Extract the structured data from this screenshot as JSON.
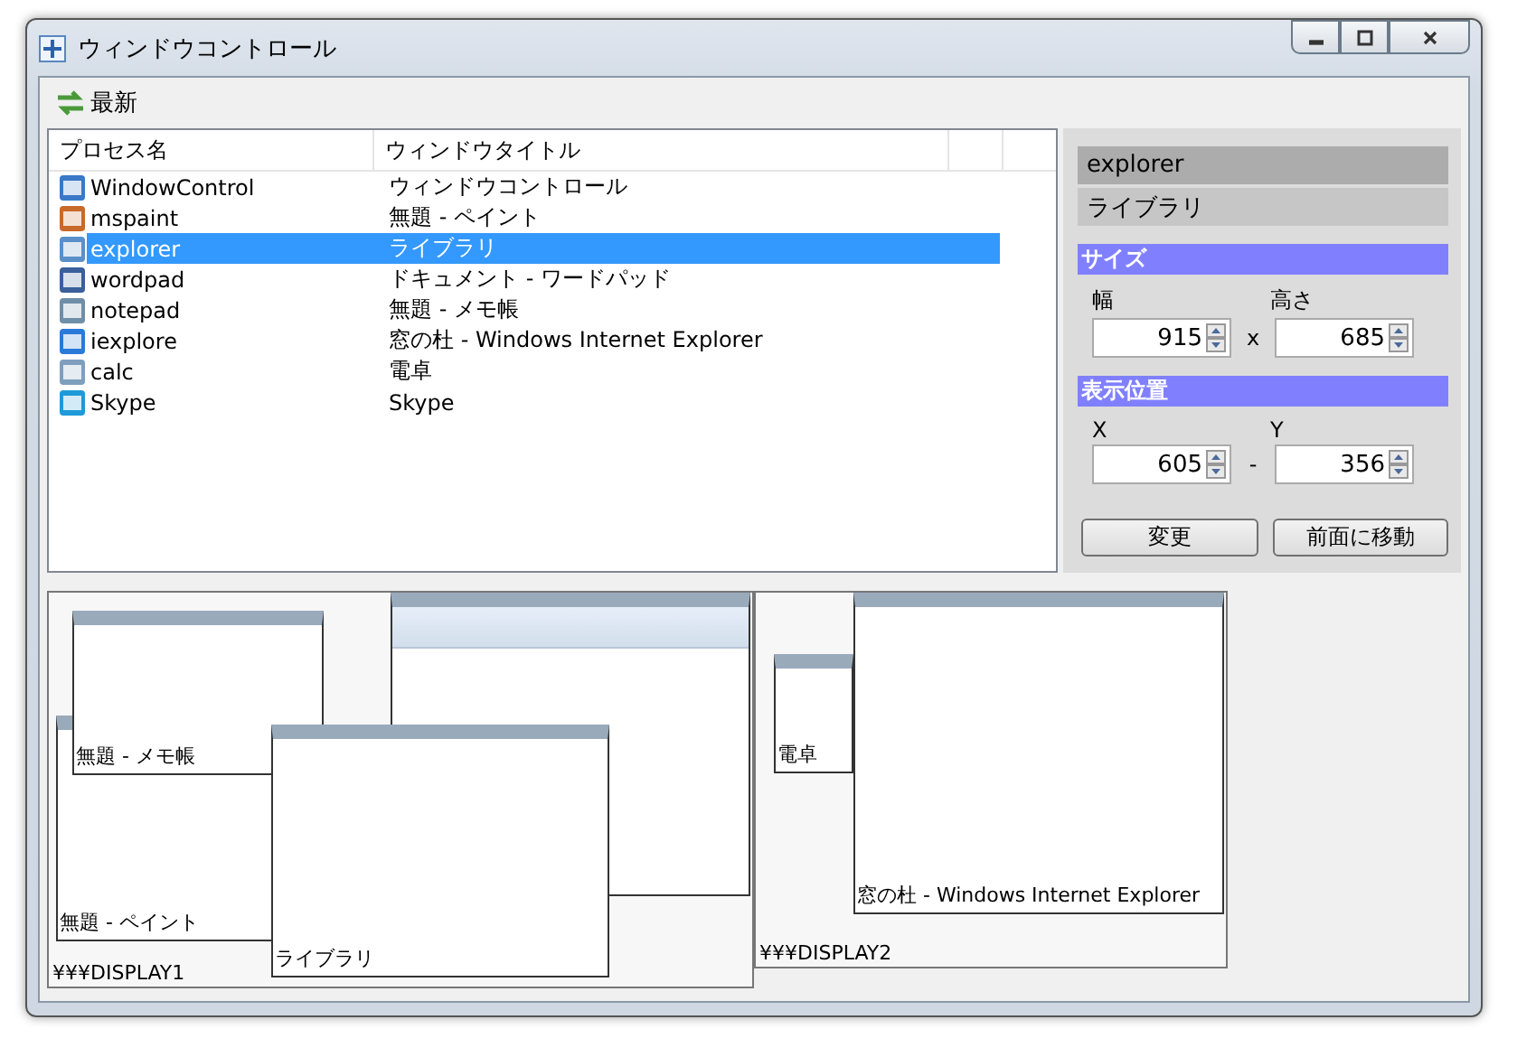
{
  "window": {
    "title": "ウィンドウコントロール"
  },
  "toolbar": {
    "refresh_button": "最新"
  },
  "process_list": {
    "columns": [
      "プロセス名",
      "ウィンドウタイトル"
    ],
    "rows": [
      {
        "process": "WindowControl",
        "title": "ウィンドウコントロール",
        "selected": false
      },
      {
        "process": "mspaint",
        "title": "無題 - ペイント",
        "selected": false
      },
      {
        "process": "explorer",
        "title": "ライブラリ",
        "selected": true
      },
      {
        "process": "wordpad",
        "title": "ドキュメント - ワードパッド",
        "selected": false
      },
      {
        "process": "notepad",
        "title": "無題 - メモ帳",
        "selected": false
      },
      {
        "process": "iexplore",
        "title": "窓の杜 - Windows Internet Explorer",
        "selected": false
      },
      {
        "process": "calc",
        "title": "電卓",
        "selected": false
      },
      {
        "process": "Skype",
        "title": "Skype",
        "selected": false
      }
    ]
  },
  "details": {
    "process": "explorer",
    "title": "ライブラリ",
    "size": {
      "heading": "サイズ",
      "first_label": "幅",
      "first_value": "915",
      "separator": "x",
      "second_label": "高さ",
      "second_value": "685"
    },
    "position": {
      "heading": "表示位置",
      "first_label": "X",
      "first_value": "605",
      "separator": "-",
      "second_label": "Y",
      "second_value": "356"
    },
    "buttons": [
      "変更",
      "前面に移動"
    ]
  },
  "displays": [
    {
      "name": "¥¥¥DISPLAY1",
      "windows": [
        {
          "label": "無題 - メモ帳"
        },
        {
          "label": "無題 - ペイント"
        },
        {
          "label": "ライブラリ"
        }
      ]
    },
    {
      "name": "¥¥¥DISPLAY2",
      "windows": [
        {
          "label": "電卓"
        },
        {
          "label": "窓の杜 - Windows Internet Explorer"
        }
      ]
    }
  ]
}
